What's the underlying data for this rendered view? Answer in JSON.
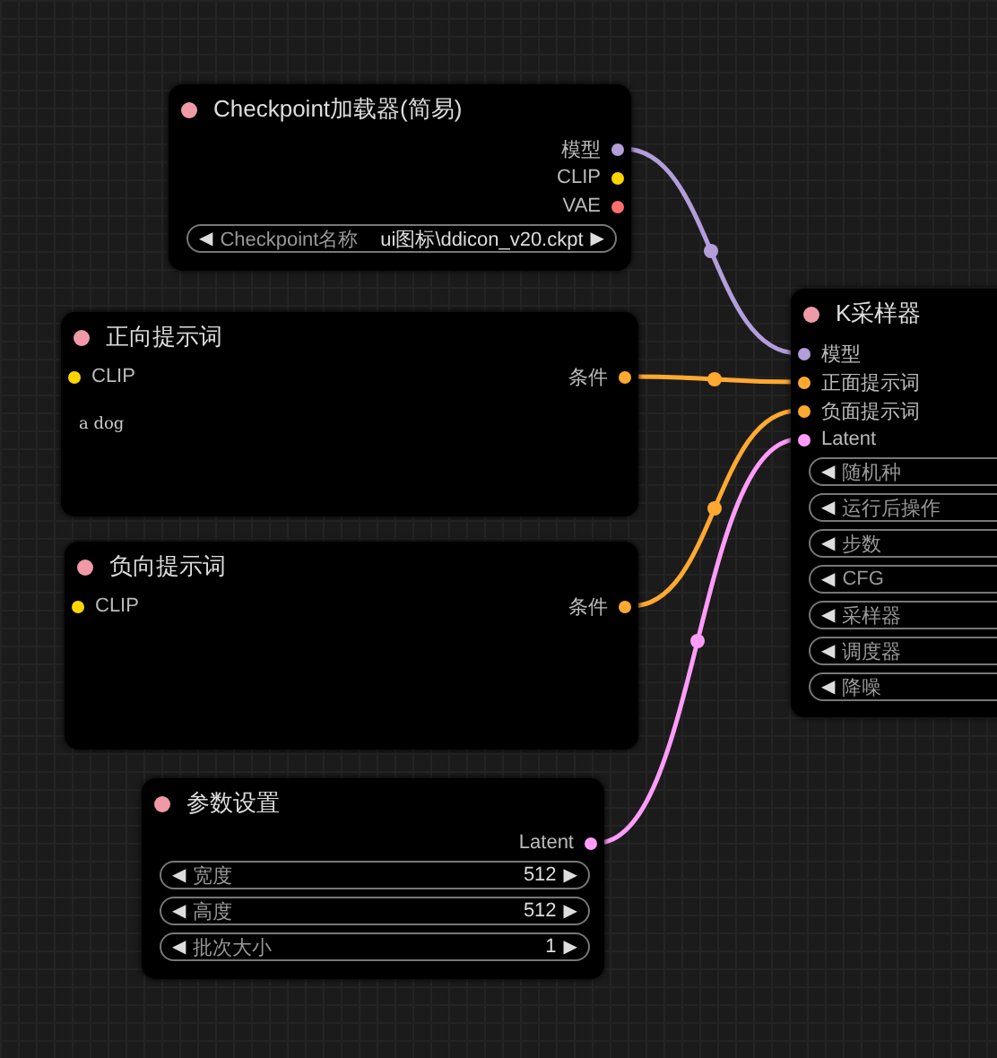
{
  "nodes": [
    {
      "title": "Checkpoint加载器(简易)",
      "outputs": [
        {
          "name": "模型",
          "color": "#b39ddb"
        },
        {
          "name": "CLIP",
          "color": "#ffd500"
        },
        {
          "name": "VAE",
          "color": "#ff6e6e"
        }
      ],
      "widgets": [
        {
          "left_arrow": "◀",
          "label": "Checkpoint名称",
          "value": "ui图标\\ddicon_v20.ckpt",
          "right_arrow": "▶"
        }
      ]
    },
    {
      "title": "正向提示词",
      "inputs": [
        {
          "name": "CLIP",
          "color": "#ffd500"
        }
      ],
      "outputs": [
        {
          "name": "条件",
          "color": "#ffa931"
        }
      ],
      "prompt": "a dog"
    },
    {
      "title": "负向提示词",
      "inputs": [
        {
          "name": "CLIP",
          "color": "#ffd500"
        }
      ],
      "outputs": [
        {
          "name": "条件",
          "color": "#ffa931"
        }
      ]
    },
    {
      "title": "参数设置",
      "outputs": [
        {
          "name": "Latent",
          "color": "#ff9cf9"
        }
      ],
      "widgets": [
        {
          "left_arrow": "◀",
          "label": "宽度",
          "value": "512",
          "right_arrow": "▶"
        },
        {
          "left_arrow": "◀",
          "label": "高度",
          "value": "512",
          "right_arrow": "▶"
        },
        {
          "left_arrow": "◀",
          "label": "批次大小",
          "value": "1",
          "right_arrow": "▶"
        }
      ]
    },
    {
      "title": "K采样器",
      "inputs": [
        {
          "name": "模型",
          "color": "#b39ddb"
        },
        {
          "name": "正面提示词",
          "color": "#ffa931"
        },
        {
          "name": "负面提示词",
          "color": "#ffa931"
        },
        {
          "name": "Latent",
          "color": "#ff9cf9"
        }
      ],
      "widgets": [
        {
          "left_arrow": "◀",
          "label": "随机种"
        },
        {
          "left_arrow": "◀",
          "label": "运行后操作"
        },
        {
          "left_arrow": "◀",
          "label": "步数"
        },
        {
          "left_arrow": "◀",
          "label": "CFG"
        },
        {
          "left_arrow": "◀",
          "label": "采样器"
        },
        {
          "left_arrow": "◀",
          "label": "调度器"
        },
        {
          "left_arrow": "◀",
          "label": "降噪"
        }
      ]
    }
  ]
}
